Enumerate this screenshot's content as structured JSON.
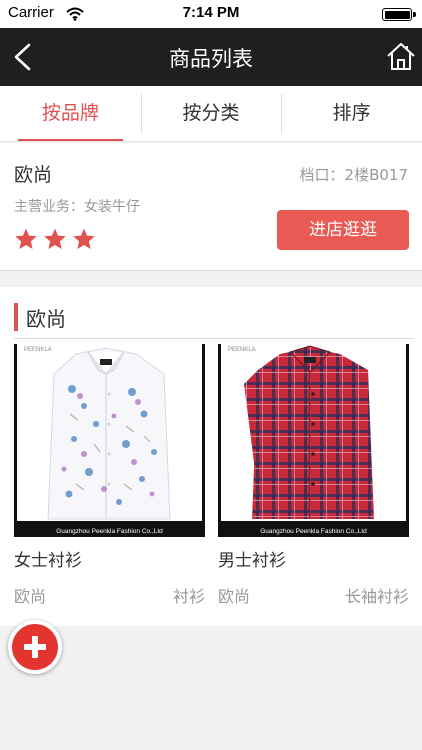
{
  "status_bar": {
    "carrier": "Carrier",
    "time": "7:14 PM"
  },
  "nav": {
    "title": "商品列表",
    "back_icon": "chevron-left-icon",
    "home_icon": "home-icon"
  },
  "tabs": [
    {
      "label": "按品牌",
      "active": true
    },
    {
      "label": "按分类",
      "active": false
    },
    {
      "label": "排序",
      "active": false
    }
  ],
  "shop": {
    "name": "欧尚",
    "stall": "档口：2楼B017",
    "business": "主营业务：女装牛仔",
    "rating": 3,
    "visit_label": "进店逛逛"
  },
  "section": {
    "title": "欧尚"
  },
  "products": [
    {
      "name": "女士衬衫",
      "shop": "欧尚",
      "category": "衬衫",
      "photo_caption": "Guangzhou Peenkla Fashion Co.,Ltd",
      "logo_text": "PEENKLA"
    },
    {
      "name": "男士衬衫",
      "shop": "欧尚",
      "category": "长袖衬衫",
      "photo_caption": "Guangzhou Peenkla Fashion Co.,Ltd",
      "logo_text": "PEENKLA"
    }
  ],
  "colors": {
    "accent": "#e0524f",
    "nav_bg": "#1f1f1f",
    "button": "#ea5a55",
    "fab": "#e3342f"
  }
}
